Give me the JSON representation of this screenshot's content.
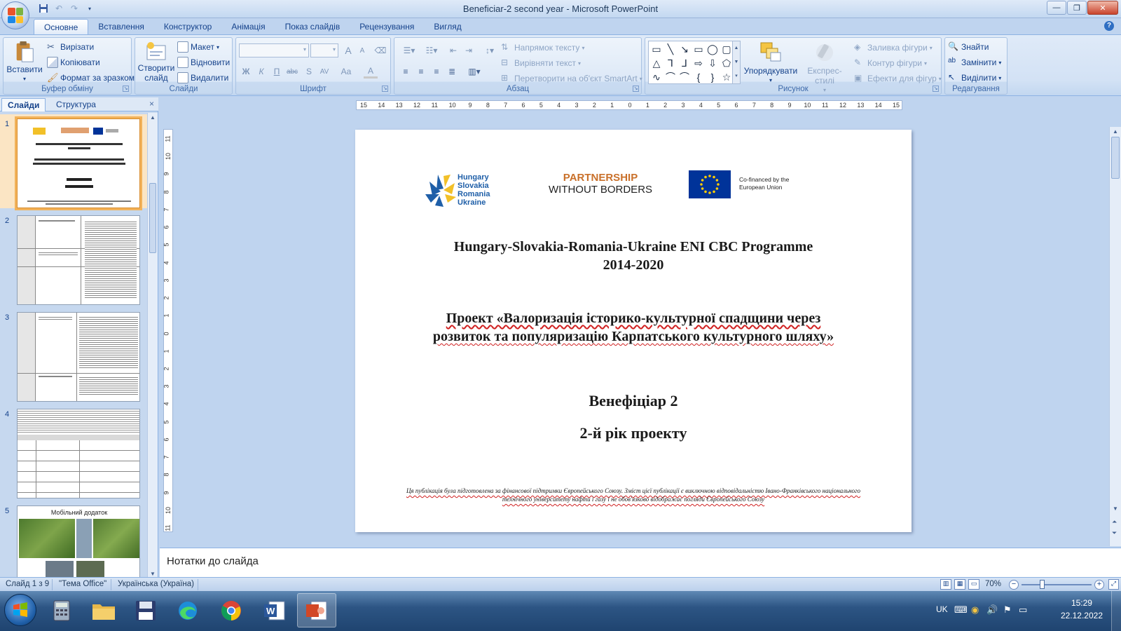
{
  "window": {
    "title": "Beneficiar-2 second year - Microsoft PowerPoint",
    "minimize": "—",
    "restore": "❐",
    "close": "✕"
  },
  "tabs": [
    "Основне",
    "Вставлення",
    "Конструктор",
    "Анімація",
    "Показ слайдів",
    "Рецензування",
    "Вигляд"
  ],
  "ribbon": {
    "clipboard": {
      "label": "Буфер обміну",
      "paste": "Вставити",
      "cut": "Вирізати",
      "copy": "Копіювати",
      "format_painter": "Формат за зразком"
    },
    "slides": {
      "label": "Слайди",
      "new_slide": "Створити слайд",
      "layout": "Макет",
      "reset": "Відновити",
      "delete": "Видалити"
    },
    "font": {
      "label": "Шрифт",
      "grow": "A",
      "shrink": "A",
      "bold": "Ж",
      "italic": "К",
      "underline": "П",
      "strike": "abc",
      "shadow": "S",
      "spacing": "AV",
      "case": "Aa",
      "color": "A"
    },
    "paragraph": {
      "label": "Абзац",
      "text_direction": "Напрямок тексту",
      "align_text": "Вирівняти текст",
      "smartart": "Перетворити на об'єкт SmartArt"
    },
    "drawing": {
      "label": "Рисунок",
      "arrange": "Упорядкувати",
      "quick_styles": "Експрес-стилі",
      "shape_fill": "Заливка фігури",
      "shape_outline": "Контур фігури",
      "shape_effects": "Ефекти для фігур"
    },
    "editing": {
      "label": "Редагування",
      "find": "Знайти",
      "replace": "Замінити",
      "select": "Виділити"
    }
  },
  "pane": {
    "tab_slides": "Слайди",
    "tab_outline": "Структура",
    "close": "×",
    "thumb_numbers": [
      "1",
      "2",
      "3",
      "4",
      "5"
    ],
    "thumb5_title": "Мобільний додаток"
  },
  "rulers": {
    "h_labels": [
      "15",
      "14",
      "13",
      "12",
      "11",
      "10",
      "9",
      "8",
      "7",
      "6",
      "5",
      "4",
      "3",
      "2",
      "1",
      "0",
      "1",
      "2",
      "3",
      "4",
      "5",
      "6",
      "7",
      "8",
      "9",
      "10",
      "11",
      "12",
      "13",
      "14",
      "15"
    ],
    "v_labels": [
      "11",
      "10",
      "9",
      "8",
      "7",
      "6",
      "5",
      "4",
      "3",
      "2",
      "1",
      "0",
      "1",
      "2",
      "3",
      "4",
      "5",
      "6",
      "7",
      "8",
      "9",
      "10",
      "11"
    ]
  },
  "slide": {
    "logo_hu": [
      "Hungary",
      "Slovakia",
      "Romania",
      "Ukraine"
    ],
    "partnership_1": "PARTNERSHIP",
    "partnership_2": "WITHOUT BORDERS",
    "cofinanced_1": "Co-financed by the",
    "cofinanced_2": "European Union",
    "programme_title": "Hungary-Slovakia-Romania-Ukraine ENI CBC Programme",
    "programme_years": "2014-2020",
    "project_line1": "Проект «Валоризація історико-культурної спадщини через",
    "project_line2": "розвиток та популяризацію Карпатського культурного шляху»",
    "beneficiary": "Венефіціар 2",
    "year": "2-й рік проекту",
    "disclaimer_1": "Ця публікація була підготовлена за фінансової підтримки Європейського Союзу. Зміст цієї публікації є виключною відповідальністю Івано-Франківського національного",
    "disclaimer_2": "технічного університету нафти і газу і не обов'язково відображає погляди Європейського Союзу"
  },
  "notes_placeholder": "Нотатки до слайда",
  "status": {
    "slide_of": "Слайд 1 з 9",
    "theme": "\"Тема Office\"",
    "language": "Українська (Україна)",
    "zoom": "70%"
  },
  "tray": {
    "lang": "UK",
    "time": "15:29",
    "date": "22.12.2022"
  },
  "colors": {
    "accent": "#15428b",
    "eu_blue": "#003399",
    "eu_yellow": "#ffcc00",
    "partnership_orange": "#c9702a",
    "selection": "#f2b25a"
  }
}
